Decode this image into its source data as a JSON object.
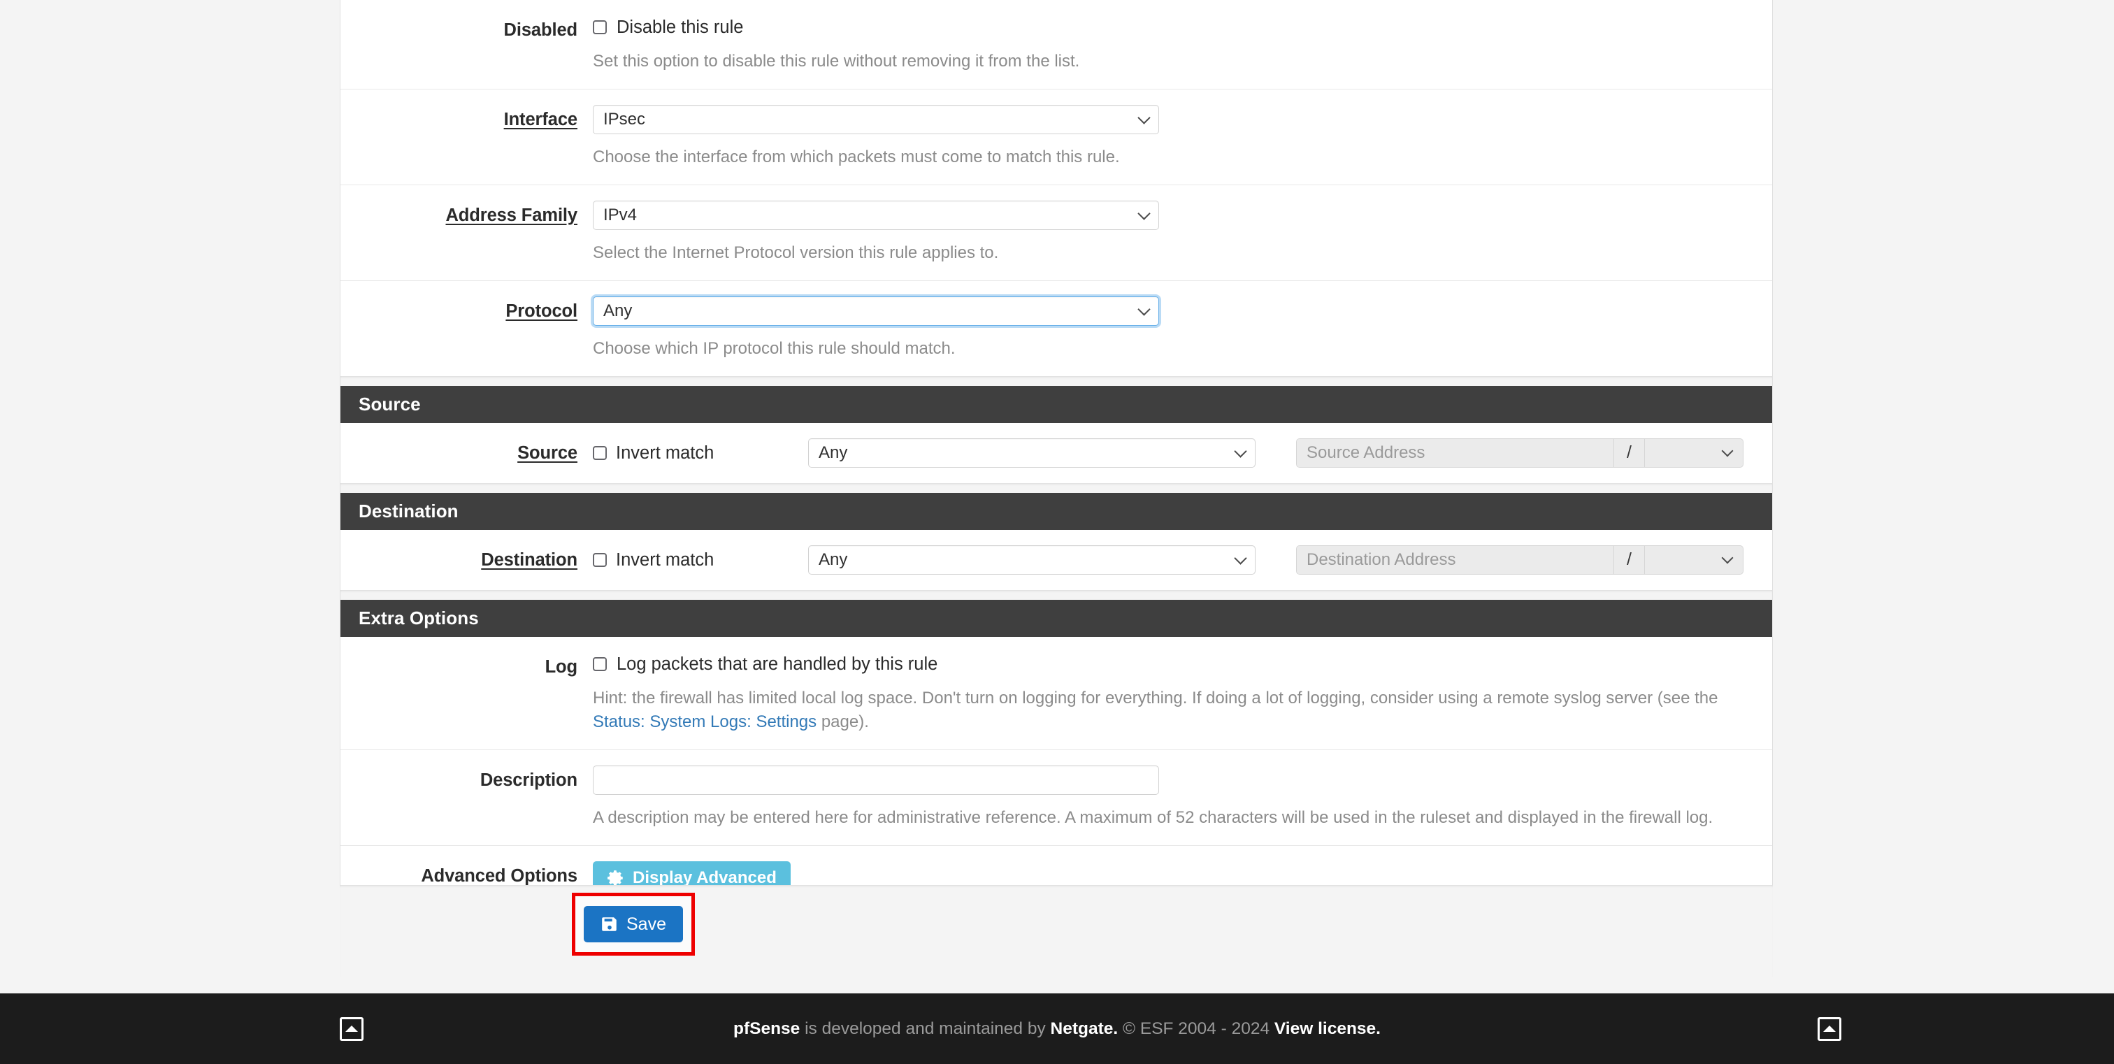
{
  "colors": {
    "section_bar": "#3f3f3f",
    "primary_button": "#1b74c4",
    "info_button": "#5bc0de",
    "link": "#337ab7",
    "highlight_box": "#ee0000",
    "focus_ring": "#66afe9",
    "page_background": "#f4f4f4",
    "footer_background": "#1c1c1c"
  },
  "form": {
    "disabled": {
      "label": "Disabled",
      "checkbox_label": "Disable this rule",
      "checked": false,
      "help": "Set this option to disable this rule without removing it from the list."
    },
    "interface": {
      "label": "Interface",
      "value": "IPsec",
      "help": "Choose the interface from which packets must come to match this rule."
    },
    "address_family": {
      "label": "Address Family",
      "value": "IPv4",
      "help": "Select the Internet Protocol version this rule applies to."
    },
    "protocol": {
      "label": "Protocol",
      "value": "Any",
      "help": "Choose which IP protocol this rule should match.",
      "focused": true
    }
  },
  "source_section": {
    "title": "Source",
    "row_label": "Source",
    "invert_label": "Invert match",
    "invert_checked": false,
    "type_value": "Any",
    "address_placeholder": "Source Address",
    "slash": "/",
    "cidr_value": ""
  },
  "destination_section": {
    "title": "Destination",
    "row_label": "Destination",
    "invert_label": "Invert match",
    "invert_checked": false,
    "type_value": "Any",
    "address_placeholder": "Destination Address",
    "slash": "/",
    "cidr_value": ""
  },
  "extra_options": {
    "title": "Extra Options",
    "log": {
      "label": "Log",
      "checkbox_label": "Log packets that are handled by this rule",
      "checked": false,
      "help_part1": "Hint: the firewall has limited local log space. Don't turn on logging for everything. If doing a lot of logging, consider using a remote syslog server (see the ",
      "help_link": "Status: System Logs: Settings",
      "help_part2": " page)."
    },
    "description": {
      "label": "Description",
      "value": "",
      "help": "A description may be entered here for administrative reference. A maximum of 52 characters will be used in the ruleset and displayed in the firewall log."
    },
    "advanced": {
      "label": "Advanced Options",
      "button_label": "Display Advanced",
      "button_icon": "gear-icon"
    }
  },
  "actions": {
    "save_label": "Save",
    "save_icon": "save-icon"
  },
  "footer": {
    "brand": "pfSense",
    "mid_text": " is developed and maintained by ",
    "company": "Netgate.",
    "copyright": " © ESF 2004 - 2024 ",
    "license": "View license.",
    "scroll_icon": "scroll-to-top-icon"
  }
}
